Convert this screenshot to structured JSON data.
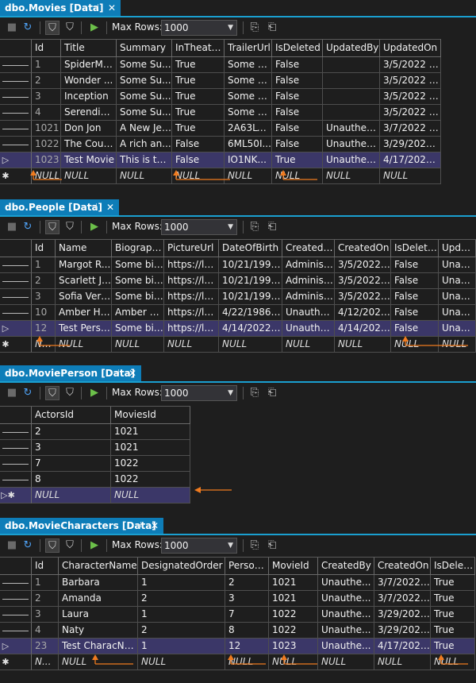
{
  "toolbar": {
    "max_rows_label": "Max Rows:",
    "max_rows_value": "1000"
  },
  "colors": {
    "tab": "#0e7db8",
    "selected_row": "#3b3768",
    "arrow": "#f07b1f"
  },
  "movies": {
    "tab_title": "dbo.Movies [Data]",
    "columns": [
      "Id",
      "Title",
      "Summary",
      "InTheaters",
      "TrailerUrl",
      "IsDeleted",
      "UpdatedBy",
      "UpdatedOn"
    ],
    "rows": [
      [
        "1",
        "SpiderMa...",
        "Some Su...",
        "True",
        "Some Tr...",
        "False",
        "",
        "3/5/2022 1..."
      ],
      [
        "2",
        "Wonder ...",
        "Some Su...",
        "True",
        "Some Tr...",
        "False",
        "",
        "3/5/2022 1..."
      ],
      [
        "3",
        "Inception",
        "Some Su...",
        "True",
        "Some Tr...",
        "False",
        "",
        "3/5/2022 1..."
      ],
      [
        "4",
        "Serendipity",
        "Some Su...",
        "True",
        "Some Tr...",
        "False",
        "",
        "3/5/2022 1..."
      ],
      [
        "1021",
        "Don Jon",
        "A New Jer...",
        "True",
        "2A63Ly0...",
        "False",
        "Unauthent...",
        "3/7/2022 1..."
      ],
      [
        "1022",
        "The Coun...",
        "A rich an...",
        "False",
        "6ML50I...",
        "False",
        "Unauthent...",
        "3/29/2022 ..."
      ],
      [
        "1023",
        "Test Movie",
        "This is the...",
        "False",
        "IO1NK...",
        "True",
        "Unauthent...",
        "4/17/2022 ..."
      ]
    ],
    "new_row": [
      "NULL",
      "NULL",
      "NULL",
      "NULL",
      "NULL",
      "NULL",
      "NULL",
      "NULL"
    ]
  },
  "people": {
    "tab_title": "dbo.People [Data]",
    "columns": [
      "Id",
      "Name",
      "Biography",
      "PictureUrl",
      "DateOfBirth",
      "CreatedBy",
      "CreatedOn",
      "IsDeleted",
      "Update"
    ],
    "rows": [
      [
        "1",
        "Margot R...",
        "Some bio...",
        "https://lo...",
        "10/21/1995 ...",
        "Administ...",
        "3/5/2022 ...",
        "False",
        "Unauth"
      ],
      [
        "2",
        "Scarlett Jo...",
        "Some bio...",
        "https://lo...",
        "10/21/1995 ...",
        "Administ...",
        "3/5/2022 ...",
        "False",
        "Unauth"
      ],
      [
        "3",
        "Sofia Verg...",
        "Some bio...",
        "https://lo...",
        "10/21/1995 ...",
        "Administ...",
        "3/5/2022 ...",
        "False",
        "Unauth"
      ],
      [
        "10",
        "Amber He...",
        "Amber L...",
        "https://lo...",
        "4/22/1986 1...",
        "Unauthe...",
        "4/12/2022...",
        "False",
        "Unauth"
      ],
      [
        "12",
        "Test Person",
        "Some bio...",
        "https://lo...",
        "4/14/2022 1...",
        "Unauthe...",
        "4/14/2022...",
        "False",
        "Unauth"
      ]
    ],
    "new_row": [
      "NULL",
      "NULL",
      "NULL",
      "NULL",
      "NULL",
      "NULL",
      "NULL",
      "NULL",
      "NULL"
    ]
  },
  "movieperson": {
    "tab_title": "dbo.MoviePerson [Data]",
    "columns": [
      "ActorsId",
      "MoviesId"
    ],
    "rows": [
      [
        "2",
        "1021"
      ],
      [
        "3",
        "1021"
      ],
      [
        "7",
        "1022"
      ],
      [
        "8",
        "1022"
      ]
    ],
    "new_row": [
      "NULL",
      "NULL"
    ]
  },
  "characters": {
    "tab_title": "dbo.MovieCharacters [Data]",
    "columns": [
      "Id",
      "CharacterName",
      "DesignatedOrder",
      "PersonId",
      "MovieId",
      "CreatedBy",
      "CreatedOn",
      "IsDeleted"
    ],
    "rows": [
      [
        "1",
        "Barbara",
        "1",
        "2",
        "1021",
        "Unauthe...",
        "3/7/2022 1...",
        "True"
      ],
      [
        "2",
        "Amanda",
        "2",
        "3",
        "1021",
        "Unauthe...",
        "3/7/2022 1...",
        "True"
      ],
      [
        "3",
        "Laura",
        "1",
        "7",
        "1022",
        "Unauthe...",
        "3/29/2022 ...",
        "True"
      ],
      [
        "4",
        "Naty",
        "2",
        "8",
        "1022",
        "Unauthe...",
        "3/29/2022 ...",
        "True"
      ],
      [
        "23",
        "Test CharacName",
        "1",
        "12",
        "1023",
        "Unauthe...",
        "4/17/2022 ...",
        "True"
      ]
    ],
    "new_row": [
      "N...",
      "NULL",
      "NULL",
      "NULL",
      "NULL",
      "NULL",
      "NULL",
      "NULL"
    ]
  }
}
